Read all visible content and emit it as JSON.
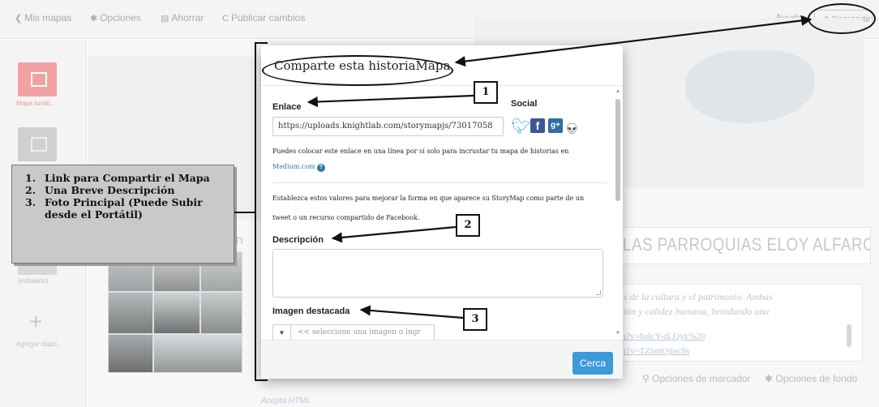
{
  "topbar": {
    "my_maps": "Mis mapas",
    "options": "Opciones",
    "save": "Ahorrar",
    "publish": "Publicar cambios",
    "help": "Ayuda",
    "share": "Compartir"
  },
  "left_panel": {
    "slide1_label": "Mapa turísti...",
    "slide3_label": "(intitulado)",
    "add_slide_label": "Agregar diapo..."
  },
  "background": {
    "headline": "LAS PARROQUIAS ELOY ALFARO Y SA",
    "left_fragment": "on",
    "desc_line1": "s de la cultura y el patrimonio. Ambas",
    "desc_line2": "ión y calidez humana, brindando una",
    "link1": "ı?v=8aIcY-dLQyk%20",
    "link2": "ı?v=TZbmOjlecSs",
    "marker_options": "Opciones de marcador",
    "background_options": "Opciones de fondo",
    "accepts": "Acepta",
    "html": "HTML"
  },
  "modal": {
    "title": "Comparte esta historiaMapa",
    "link_label": "Enlace",
    "social_label": "Social",
    "url": "https://uploads.knightlab.com/storymapjs/73017058",
    "embed_text": "Puedes colocar este enlace en una línea por sí solo para incrustar tu mapa de historias en",
    "medium_link": "Medium.com",
    "info_line1": "Establezca estos valores para mejorar la forma en que aparece su StoryMap como parte de un",
    "info_line2": "tweet o un recurso compartido de Facebook.",
    "description_label": "Descripción",
    "featured_image_label": "Imagen destacada",
    "image_placeholder": "<< seleccione una imagen o ingr",
    "close_button": "Cerca"
  },
  "annotations": {
    "n1": "1",
    "n2": "2",
    "n3": "3",
    "legend": [
      {
        "num": "1.",
        "text": "Link para Compartir el Mapa"
      },
      {
        "num": "2.",
        "text": "Una Breve Descripción"
      },
      {
        "num": "3.",
        "text": "Foto Principal (Puede Subir desde el Portátil)"
      }
    ]
  },
  "icons": {
    "back": "chevron-left-icon",
    "options": "gear-icon",
    "save": "save-icon",
    "publish": "refresh-icon",
    "share": "share-icon",
    "twitter": "twitter-icon",
    "facebook": "facebook-icon",
    "googleplus": "google-plus-icon",
    "reddit": "reddit-icon",
    "help": "help-icon",
    "marker": "map-marker-icon"
  },
  "colors": {
    "close_button": "#3c9ad8",
    "twitter": "#55acee",
    "facebook": "#3b5998",
    "link": "#2a7ab0",
    "active_slide": "#f2a2a2"
  }
}
